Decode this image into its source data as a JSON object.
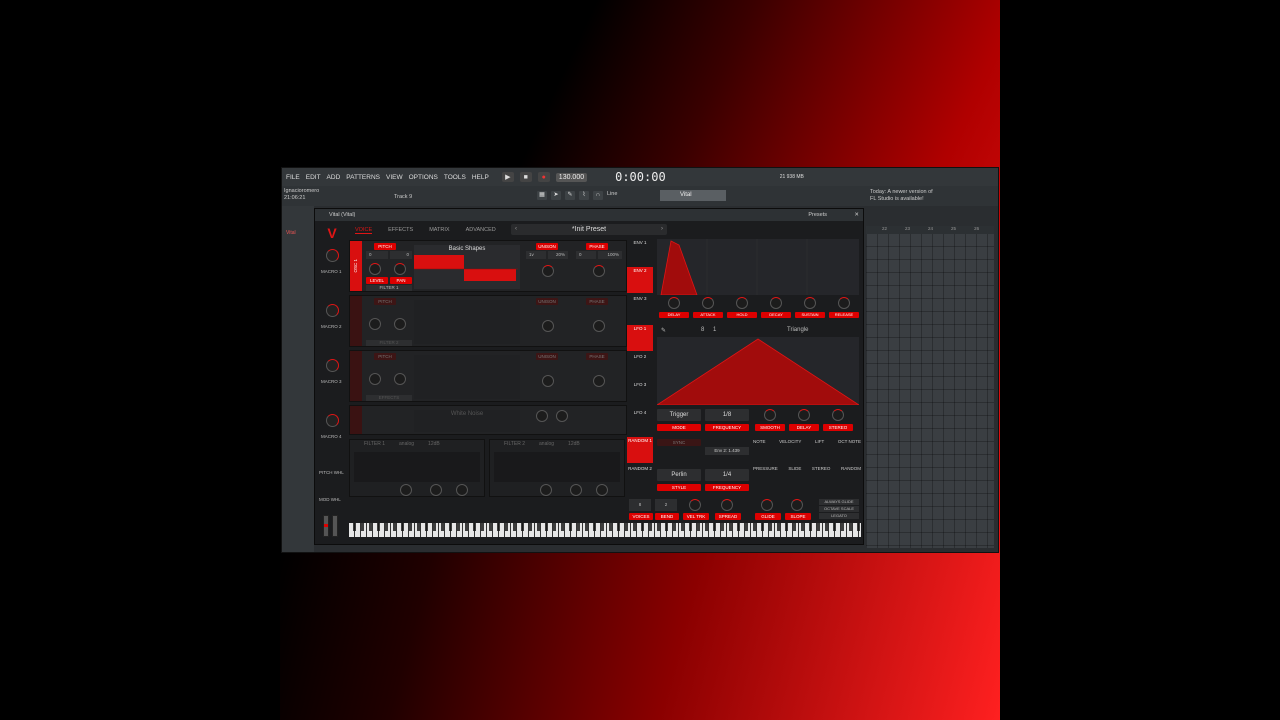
{
  "colors": {
    "accent": "#d90f0f",
    "panel": "#1b1c1e",
    "fl_bg": "#2a2d30"
  },
  "fl": {
    "menu": [
      "FILE",
      "EDIT",
      "ADD",
      "PATTERNS",
      "VIEW",
      "OPTIONS",
      "TOOLS",
      "HELP"
    ],
    "tempo": "130.000",
    "time": "0:00:00",
    "cpu": "21",
    "ram": "938 MB",
    "hint_user": "Ignacioromero",
    "hint_time": "21:06:21",
    "track_label": "Track 9",
    "line_mode": "Line",
    "channel_name": "Vital",
    "news_line1": "Today: A newer version of",
    "news_line2": "FL Studio is available!",
    "left_panel_item": "Vital",
    "playlist_ruler": [
      "22",
      "23",
      "24",
      "25",
      "26"
    ]
  },
  "vital": {
    "window_title": "Vital (Vital)",
    "presets_label": "Presets",
    "tabs": [
      "VOICE",
      "EFFECTS",
      "MATRIX",
      "ADVANCED"
    ],
    "preset_name": "*Init Preset",
    "macros": [
      "MACRO 1",
      "MACRO 2",
      "MACRO 3",
      "MACRO 4"
    ],
    "wheels": [
      "PITCH WHL",
      "MOD WHL"
    ],
    "osc1": {
      "label": "OSC 1",
      "pitch": "PITCH",
      "pitch_values": [
        "0",
        "0"
      ],
      "wave_name": "Basic Shapes",
      "unison": "UNISON",
      "unison_values": [
        "1v",
        "20%"
      ],
      "phase": "PHASE",
      "phase_values": [
        "0",
        "100%"
      ],
      "level": "LEVEL",
      "pan": "PAN",
      "filter": "FILTER 1"
    },
    "osc2": {
      "filter": "FILTER 2",
      "pitch": "PITCH",
      "unison": "UNISON",
      "phase": "PHASE"
    },
    "osc3": {
      "filter": "EFFECTS",
      "pitch": "PITCH",
      "unison": "UNISON",
      "phase": "PHASE"
    },
    "sample": {
      "wave_name": "White Noise"
    },
    "filters": [
      {
        "name": "FILTER 1",
        "model": "analog",
        "type": "12dB"
      },
      {
        "name": "FILTER 2",
        "model": "analog",
        "type": "12dB"
      }
    ],
    "envs": [
      "ENV 1",
      "ENV 2",
      "ENV 3"
    ],
    "env_knobs": [
      "DELAY",
      "ATTACK",
      "HOLD",
      "DECAY",
      "SUSTAIN",
      "RELEASE"
    ],
    "lfos": [
      "LFO 1",
      "LFO 2",
      "LFO 3",
      "LFO 4"
    ],
    "lfo_shape": "Triangle",
    "lfo_grid": "8",
    "lfo_div": "1",
    "lfo_mode": "Trigger",
    "lfo_freq": "1/8",
    "lfo_knob_labels": [
      "MODE",
      "FREQUENCY",
      "SMOOTH",
      "DELAY",
      "STEREO"
    ],
    "randoms": [
      "RANDOM 1",
      "RANDOM 2"
    ],
    "random_style": "Perlin",
    "random_freq": "1/4",
    "random_labels": [
      "STYLE",
      "FREQUENCY"
    ],
    "random_sync_label": "SYNC",
    "tooltip": "Env 2: 1.439",
    "mod_sources": [
      "NOTE",
      "VELOCITY",
      "LIFT",
      "OCT NOTE",
      "PRESSURE",
      "SLIDE",
      "STEREO",
      "RANDOM"
    ],
    "voice_values": [
      "8",
      "2"
    ],
    "voice_labels": [
      "VOICES",
      "BEND",
      "VEL TRK",
      "SPREAD",
      "GLIDE",
      "SLOPE"
    ],
    "voice_toggles": [
      "ALWAYS GLIDE",
      "OCTAVE SCALE",
      "LEGATO"
    ]
  }
}
